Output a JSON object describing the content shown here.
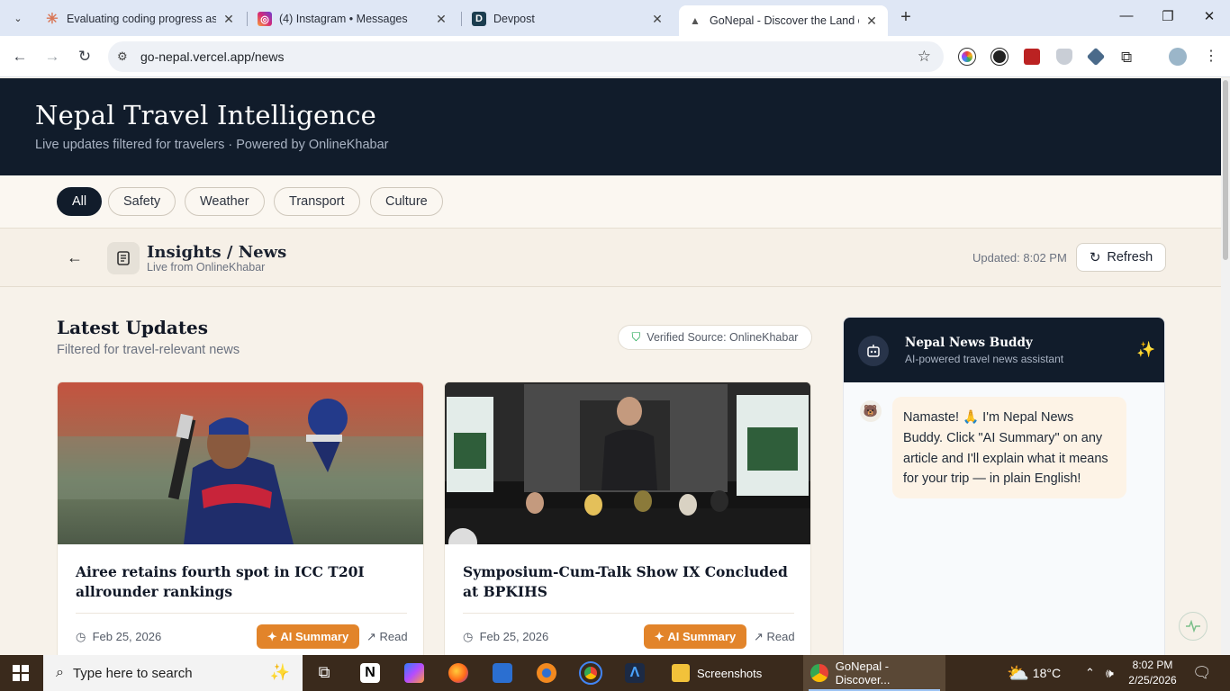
{
  "browser": {
    "tabs": [
      {
        "title": "Evaluating coding progress as a"
      },
      {
        "title": "(4) Instagram • Messages"
      },
      {
        "title": "Devpost"
      },
      {
        "title": "GoNepal - Discover the Land of"
      }
    ],
    "url": "go-nepal.vercel.app/news"
  },
  "hero": {
    "title": "Nepal Travel Intelligence",
    "subtitle": "Live updates filtered for travelers · Powered by OnlineKhabar"
  },
  "filters": [
    "All",
    "Safety",
    "Weather",
    "Transport",
    "Culture"
  ],
  "subheader": {
    "title": "Insights / News",
    "subtitle": "Live from OnlineKhabar",
    "updated": "Updated: 8:02 PM",
    "refresh_label": "Refresh"
  },
  "section": {
    "title": "Latest Updates",
    "subtitle": "Filtered for travel-relevant news",
    "verified": "Verified Source: OnlineKhabar"
  },
  "articles": [
    {
      "title": "Airee retains fourth spot in ICC T20I allrounder rankings",
      "date": "Feb 25, 2026",
      "ai_label": "AI Summary",
      "read_label": "Read"
    },
    {
      "title": "Symposium-Cum-Talk Show IX Concluded at BPKIHS",
      "date": "Feb 25, 2026",
      "ai_label": "AI Summary",
      "read_label": "Read"
    }
  ],
  "buddy": {
    "name": "Nepal News Buddy",
    "tagline": "AI-powered travel news assistant",
    "message": "Namaste! 🙏 I'm Nepal News Buddy. Click \"AI Summary\" on any article and I'll explain what it means for your trip — in plain English!"
  },
  "taskbar": {
    "search_placeholder": "Type here to search",
    "apps": [
      {
        "label": "Screenshots"
      },
      {
        "label": "GoNepal - Discover..."
      }
    ],
    "weather": "18°C",
    "time": "8:02 PM",
    "date": "2/25/2026"
  },
  "colors": {
    "navy": "#111c2b",
    "accent_orange": "#e2842a",
    "cream": "#f7f2ea",
    "verified_green": "#16a34a"
  }
}
